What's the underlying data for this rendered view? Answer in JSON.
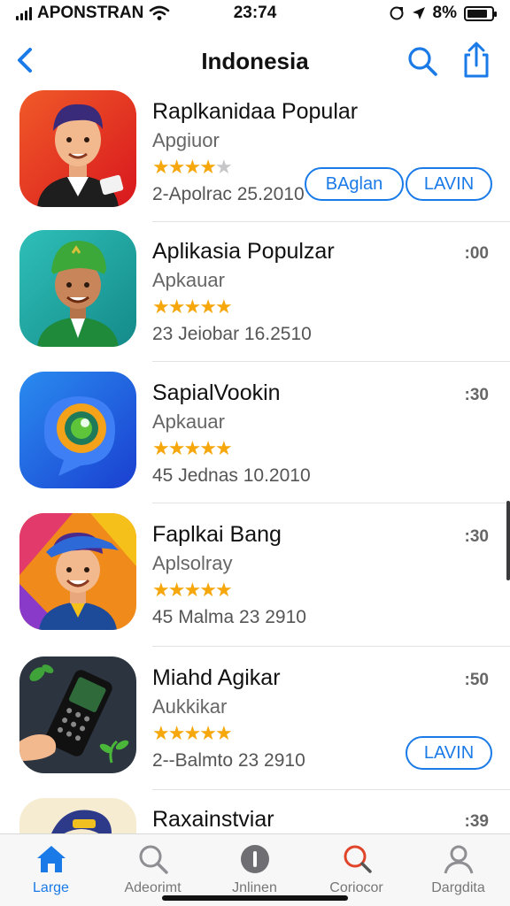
{
  "status_bar": {
    "carrier": "APONSTRAN",
    "time": "23:74",
    "battery_text": "8%",
    "battery_level": 0.85
  },
  "nav": {
    "title": "Indonesia",
    "back_icon": "chevron-left-icon",
    "search_icon": "search-icon",
    "share_icon": "share-icon"
  },
  "apps": [
    {
      "name": "Raplkanidaa Popular",
      "subtitle": "Apgiuor",
      "rating": 3.5,
      "date": "2-Apolrac 25.2010",
      "size": "",
      "buttons": [
        "BAglan",
        "LAVIN"
      ]
    },
    {
      "name": "Aplikasia Populzar",
      "subtitle": "Apkauar",
      "rating": 4.5,
      "date": "23 Jeiobar 16.2510",
      "size": ":00",
      "buttons": []
    },
    {
      "name": "SapialVookin",
      "subtitle": "Apkauar",
      "rating": 4.5,
      "date": "45 Jednas 10.2010",
      "size": ":30",
      "buttons": []
    },
    {
      "name": "Faplkai Bang",
      "subtitle": "Aplsolray",
      "rating": 4.5,
      "date": "45 Malma 23 2910",
      "size": ":30",
      "buttons": []
    },
    {
      "name": "Miahd Agikar",
      "subtitle": "Aukkikar",
      "rating": 4.5,
      "date": "2--Balmto 23 2910",
      "size": ":50",
      "buttons": [
        "LAVIN"
      ]
    },
    {
      "name": "Raxainstviar",
      "subtitle": "",
      "rating": 0,
      "date": "",
      "size": ":39",
      "buttons": []
    }
  ],
  "tabs": [
    {
      "label": "Large",
      "icon": "home-icon",
      "active": true
    },
    {
      "label": "Adeorimt",
      "icon": "search-icon",
      "active": false
    },
    {
      "label": "Jnlinen",
      "icon": "info-icon",
      "active": false
    },
    {
      "label": "Coriocor",
      "icon": "magnifier-red-icon",
      "active": false
    },
    {
      "label": "Dargdita",
      "icon": "person-icon",
      "active": false
    }
  ],
  "colors": {
    "accent": "#1a7ae8",
    "star": "#f5a70c",
    "star_empty": "#c6c6c8",
    "tab_bar": "#f7f7f7"
  }
}
